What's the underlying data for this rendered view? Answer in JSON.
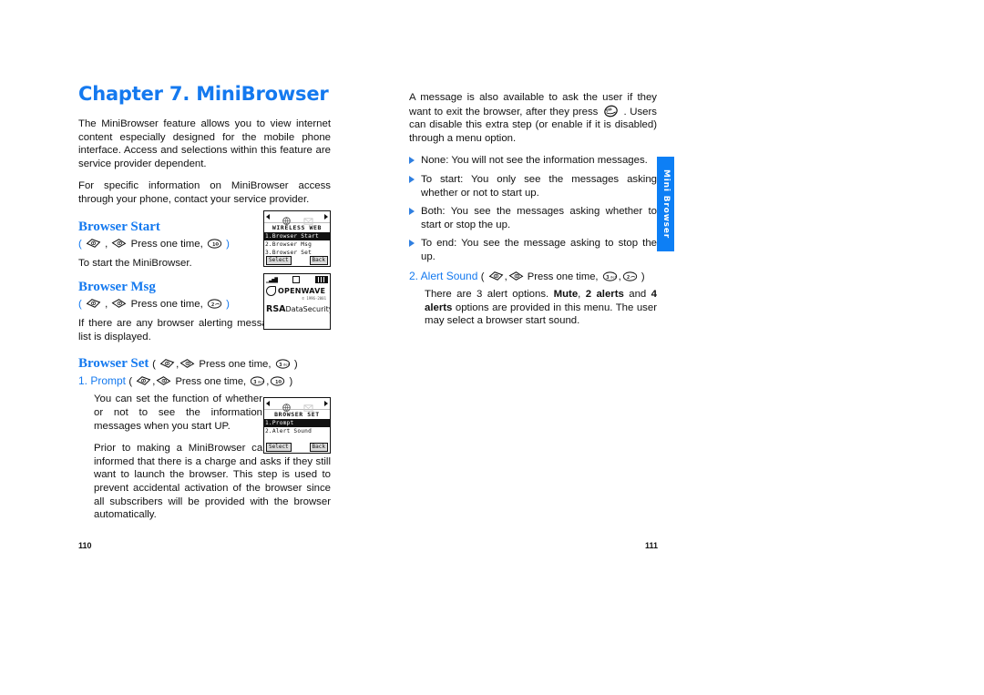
{
  "document": {
    "chapter_title": "Chapter 7. MiniBrowser",
    "page_number_left": "110",
    "page_number_right": "111",
    "side_tab_label": "Mini Browser",
    "accent_color": "#1479ef",
    "tab_color": "#0d7ff5"
  },
  "left_column": {
    "intro_paragraphs": [
      "The MiniBrowser feature allows you to view internet content especially designed for the mobile phone interface. Access and selections within this feature are service provider dependent.",
      "For specific information on MiniBrowser access through your phone, contact your service provider."
    ],
    "sections": [
      {
        "heading": "Browser Start",
        "key_prefix": "(",
        "key_text": "Press one time,",
        "key_suffix": ")",
        "body": "To start the MiniBrowser."
      },
      {
        "heading": "Browser Msg",
        "key_prefix": "(",
        "key_text": "Press one time,",
        "key_suffix": ")",
        "body": "If there are any browser alerting messages, then the list is displayed."
      }
    ],
    "browser_set": {
      "heading": "Browser Set",
      "heading_key_open": "(",
      "heading_key_text": "Press one time,",
      "heading_key_close": ")",
      "sub_item": "1. Prompt",
      "sub_key_open": "(",
      "sub_key_text": "Press one time,",
      "sub_key_close": ")",
      "paragraphs": [
        "You can set the function of whether or not to see the information messages when you start UP.",
        "Prior to making a MiniBrowser call, the user is informed that there is a charge and asks if they still want to launch the browser. This step is used to prevent accidental activation of the browser since all subscribers will be provided with the browser automatically."
      ]
    }
  },
  "right_column": {
    "paragraph_parts": {
      "before_key": "A message is also available to ask the user if they want to exit the browser, after they press",
      "after_key": ". Users can disable this extra step (or enable if it is disabled) through a menu option."
    },
    "bullets": [
      "None: You will not see the information messages.",
      "To start: You only see the messages asking whether or not to start up.",
      "Both: You see the messages asking whether to start or stop the up.",
      "To end: You see the message asking to stop the up."
    ],
    "alert_sound": {
      "label": "2. Alert Sound",
      "key_open": "(",
      "key_text": "Press one time,",
      "key_close": ")",
      "body_part1": "There are 3 alert options. ",
      "body_bold1": "Mute",
      "body_part2": ", ",
      "body_bold2": "2 alerts",
      "body_part3": " and ",
      "body_bold3": "4 alerts",
      "body_part4": " options are provided in this menu. The user may select a browser start sound."
    }
  },
  "phone_screens": {
    "wireless_web": {
      "title": "WIRELESS WEB",
      "rows": [
        "1.Browser Start",
        "2.Browser Msg",
        "3.Browser Set"
      ],
      "selected_index": 0,
      "softkey_left": "Select",
      "softkey_right": "Back"
    },
    "openwave": {
      "brand": "OPENWAVE",
      "tiny": "© 1996-2001",
      "rsa_bold": "RSA",
      "rsa_rest": "DataSecurity"
    },
    "browser_set": {
      "title": "BROWSER SET",
      "rows": [
        "1.Prompt",
        "2.Alert Sound"
      ],
      "selected_index": 0,
      "softkey_left": "Select",
      "softkey_right": "Back"
    }
  },
  "key_icons": {
    "nav_key": "nav-diamond-key",
    "num_key_1": "number-key-1",
    "num_key_2": "number-key-2",
    "num_key_3": "number-key-3",
    "end_key": "end-exit-key"
  }
}
